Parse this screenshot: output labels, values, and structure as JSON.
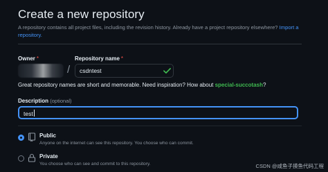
{
  "page": {
    "title": "Create a new repository",
    "subtitle": "A repository contains all project files, including the revision history. Already have a project repository elsewhere?",
    "import_link": "Import a repository."
  },
  "owner": {
    "label": "Owner",
    "required_mark": "*"
  },
  "repo_name": {
    "label": "Repository name",
    "required_mark": "*",
    "value": "csdntest",
    "separator": "/"
  },
  "hint": {
    "text": "Great repository names are short and memorable. Need inspiration? How about ",
    "suggestion": "special-succotash",
    "suffix": "?"
  },
  "description": {
    "label": "Description",
    "optional": "(optional)",
    "value": "test"
  },
  "visibility": {
    "public": {
      "title": "Public",
      "desc": "Anyone on the internet can see this repository. You choose who can commit.",
      "selected": true
    },
    "private": {
      "title": "Private",
      "desc": "You choose who can see and commit to this repository.",
      "selected": false
    }
  },
  "watermark": "CSDN @咸鱼子摸鱼代码工程",
  "colors": {
    "background": "#0d1117",
    "accent": "#4493f8",
    "success": "#3fb950",
    "required": "#f85149"
  }
}
